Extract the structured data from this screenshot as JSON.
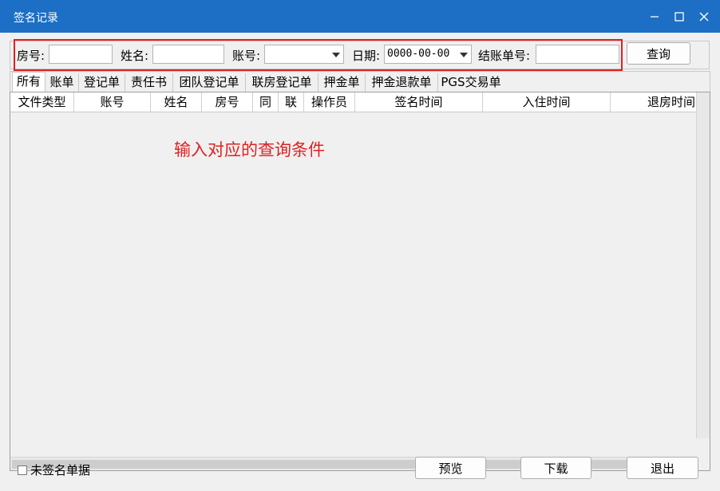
{
  "window": {
    "title": "签名记录",
    "controls": [
      "minimize-icon",
      "maximize-icon",
      "close-icon"
    ]
  },
  "query": {
    "room_label": "房号:",
    "room_value": "",
    "name_label": "姓名:",
    "name_value": "",
    "account_label": "账号:",
    "account_value": "",
    "date_label": "日期:",
    "date_value": "0000-00-00",
    "checkout_label": "结账单号:",
    "checkout_value": "",
    "search_button": "查询"
  },
  "tabs": [
    "所有",
    "账单",
    "登记单",
    "责任书",
    "团队登记单",
    "联房登记单",
    "押金单",
    "押金退款单",
    "PGS交易单"
  ],
  "grid": {
    "columns": [
      "文件类型",
      "账号",
      "姓名",
      "房号",
      "同",
      "联",
      "操作员",
      "签名时间",
      "入住时间",
      "退房时间"
    ],
    "rows": [],
    "hint": "输入对应的查询条件"
  },
  "footer": {
    "unsigned_label": "未签名单据",
    "unsigned_checked": false,
    "preview_button": "预览",
    "download_button": "下载",
    "exit_button": "退出"
  },
  "colors": {
    "titlebar": "#1c6fc4",
    "highlight": "#e02020"
  }
}
